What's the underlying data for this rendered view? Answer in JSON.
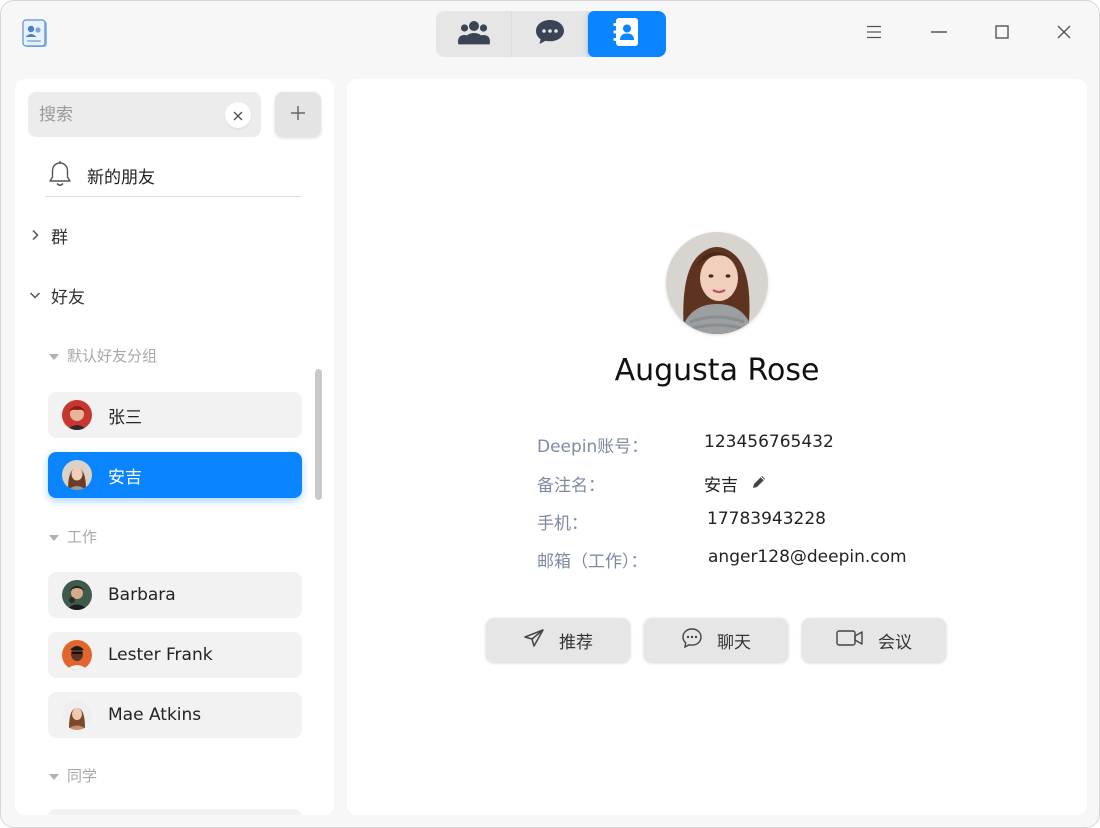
{
  "titlebar": {
    "app_icon": "contacts-app-icon",
    "mode_tabs": [
      {
        "icon": "group-icon",
        "active": false
      },
      {
        "icon": "chat-bubble-icon",
        "active": false
      },
      {
        "icon": "contact-card-icon",
        "active": true
      }
    ],
    "window_controls": [
      "menu-icon",
      "minimize-icon",
      "maximize-icon",
      "close-icon"
    ]
  },
  "sidebar": {
    "search": {
      "placeholder": "搜索",
      "value": ""
    },
    "new_friends_label": "新的朋友",
    "sections": [
      {
        "label": "群",
        "expanded": false
      },
      {
        "label": "好友",
        "expanded": true
      }
    ],
    "groups": [
      {
        "label": "默认好友分组",
        "contacts": [
          {
            "name": "张三",
            "selected": false
          },
          {
            "name": "安吉",
            "selected": true
          }
        ]
      },
      {
        "label": "工作",
        "contacts": [
          {
            "name": "Barbara",
            "selected": false
          },
          {
            "name": "Lester Frank",
            "selected": false
          },
          {
            "name": "Mae Atkins",
            "selected": false
          }
        ]
      },
      {
        "label": "同学",
        "contacts": []
      }
    ]
  },
  "profile": {
    "name": "Augusta Rose",
    "fields": [
      {
        "key": "Deepin账号：",
        "value": "123456765432"
      },
      {
        "key": "备注名：",
        "value": "安吉"
      },
      {
        "key": "手机：",
        "value": "17783943228"
      },
      {
        "key": "邮箱（工作）：",
        "value": "anger128@deepin.com"
      }
    ],
    "actions": [
      {
        "label": "推荐",
        "icon": "send-icon"
      },
      {
        "label": "聊天",
        "icon": "chat-icon"
      },
      {
        "label": "会议",
        "icon": "video-camera-icon"
      }
    ]
  },
  "colors": {
    "accent": "#0a84ff",
    "label_gray": "#7f8aa3",
    "group_gray": "#a8a8a8"
  }
}
